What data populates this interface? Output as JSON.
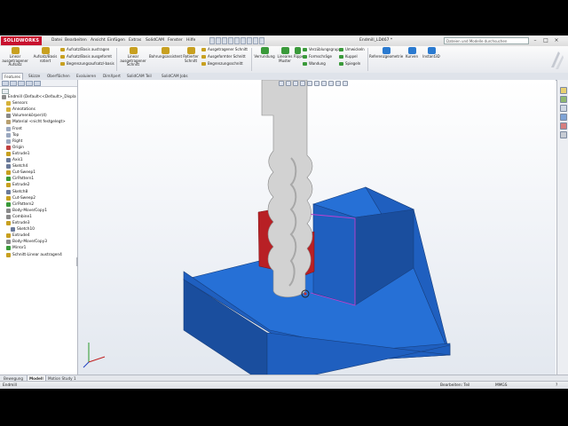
{
  "app": {
    "logo": "SOLIDWORKS",
    "document_title": "Endmill_LD467 *",
    "search_placeholder": "Dateien und Modelle durchsuchen"
  },
  "menu": [
    "Datei",
    "Bearbeiten",
    "Ansicht",
    "Einfügen",
    "Extras",
    "SolidCAM",
    "Fenster",
    "Hilfe"
  ],
  "window_controls": [
    "–",
    "□",
    "×"
  ],
  "ribbon": {
    "large_buttons": [
      {
        "label": "Linear ausgetragener Aufsatz",
        "color": "#c8a020"
      },
      {
        "label": "Aufsatz/Basis rotiert",
        "color": "#c8a020"
      },
      {
        "label": "Linear ausgetragener Schnitt",
        "color": "#c8a020"
      },
      {
        "label": "Bohrungsassistent",
        "color": "#c8a020"
      },
      {
        "label": "Rotierter Schnitt",
        "color": "#c8a020"
      },
      {
        "label": "Verrundung",
        "color": "#3a9a3a"
      },
      {
        "label": "Lineares Muster",
        "color": "#3a9a3a"
      },
      {
        "label": "Rippe",
        "color": "#3a9a3a"
      },
      {
        "label": "Referenzgeometrie",
        "color": "#2a7ad0"
      },
      {
        "label": "Kurven",
        "color": "#2a7ad0"
      },
      {
        "label": "Instant3D",
        "color": "#2a7ad0"
      }
    ],
    "small_buttons": [
      {
        "label": "Aufsatz/Basis austragen",
        "color": "#c8a020"
      },
      {
        "label": "Aufsatz/Basis ausgeformt",
        "color": "#c8a020"
      },
      {
        "label": "Begrenzungsaufsatz/-basis",
        "color": "#c8a020"
      },
      {
        "label": "Ausgetragener Schnitt",
        "color": "#c8a020"
      },
      {
        "label": "Ausgeformter Schnitt",
        "color": "#c8a020"
      },
      {
        "label": "Begrenzungsschnitt",
        "color": "#c8a020"
      },
      {
        "label": "Verzüblungsgruppe",
        "color": "#3a9a3a"
      },
      {
        "label": "Formschräge",
        "color": "#3a9a3a"
      },
      {
        "label": "Wandung",
        "color": "#3a9a3a"
      },
      {
        "label": "Umwickeln",
        "color": "#3a9a3a"
      },
      {
        "label": "Kuppel",
        "color": "#3a9a3a"
      },
      {
        "label": "Spiegeln",
        "color": "#3a9a3a"
      }
    ]
  },
  "command_tabs": [
    "Features",
    "Skizze",
    "Oberflächen",
    "Evaluieren",
    "DimXpert",
    "SolidCAM Teil",
    "SolidCAM Jobs"
  ],
  "feature_tree": [
    {
      "label": "Endmill  (Default<<Default>_Displa",
      "indent": 0,
      "color": "#8a8a8a"
    },
    {
      "label": "Sensors",
      "indent": 1,
      "color": "#d6b23a"
    },
    {
      "label": "Annotations",
      "indent": 1,
      "color": "#d6b23a"
    },
    {
      "label": "Volumenkörper(4)",
      "indent": 1,
      "color": "#8a8a8a"
    },
    {
      "label": "Material <nicht festgelegt>",
      "indent": 1,
      "color": "#b8a070"
    },
    {
      "label": "Front",
      "indent": 1,
      "color": "#9aa8c0"
    },
    {
      "label": "Top",
      "indent": 1,
      "color": "#9aa8c0"
    },
    {
      "label": "Right",
      "indent": 1,
      "color": "#9aa8c0"
    },
    {
      "label": "Origin",
      "indent": 1,
      "color": "#c04040"
    },
    {
      "label": "Extrude1",
      "indent": 1,
      "color": "#c8a020"
    },
    {
      "label": "Axis1",
      "indent": 1,
      "color": "#6a7a9a"
    },
    {
      "label": "Sketch4",
      "indent": 1,
      "color": "#6a7a9a"
    },
    {
      "label": "Cut-Sweep1",
      "indent": 1,
      "color": "#c8a020"
    },
    {
      "label": "CirPattern1",
      "indent": 1,
      "color": "#3a9a3a"
    },
    {
      "label": "Extrude2",
      "indent": 1,
      "color": "#c8a020"
    },
    {
      "label": "Sketch8",
      "indent": 1,
      "color": "#6a7a9a"
    },
    {
      "label": "Cut-Sweep2",
      "indent": 1,
      "color": "#c8a020"
    },
    {
      "label": "CirPattern2",
      "indent": 1,
      "color": "#3a9a3a"
    },
    {
      "label": "Body-Move/Copy1",
      "indent": 1,
      "color": "#8a8a8a"
    },
    {
      "label": "Combine1",
      "indent": 1,
      "color": "#8a8a8a"
    },
    {
      "label": "Extrude3",
      "indent": 1,
      "color": "#c8a020"
    },
    {
      "label": "Sketch10",
      "indent": 2,
      "color": "#6a7a9a"
    },
    {
      "label": "Extrude4",
      "indent": 1,
      "color": "#c8a020"
    },
    {
      "label": "Body-Move/Copy3",
      "indent": 1,
      "color": "#8a8a8a"
    },
    {
      "label": "Mirror1",
      "indent": 1,
      "color": "#3a9a3a"
    },
    {
      "label": "Schnitt-Linear austragen4",
      "indent": 1,
      "color": "#c8a020"
    }
  ],
  "bottom_tabs": [
    "Bewegung",
    "Modell",
    "Motion Study 1"
  ],
  "active_bottom_tab": "Modell",
  "status": {
    "left": "Endmill",
    "mode": "Bearbeiten: Teil",
    "units": "MMGS",
    "help": "?"
  },
  "colors": {
    "block_blue": "#1f5fbf",
    "block_side": "#1a4e9e",
    "block_top": "#2670d6",
    "cutter_gray": "#d2d2d2",
    "cutter_shadow": "#a8a8a8",
    "cut_red": "#b82025",
    "highlight_edge": "#c040d0",
    "background_top": "#ffffff",
    "background_bottom": "#e3e8ef"
  }
}
